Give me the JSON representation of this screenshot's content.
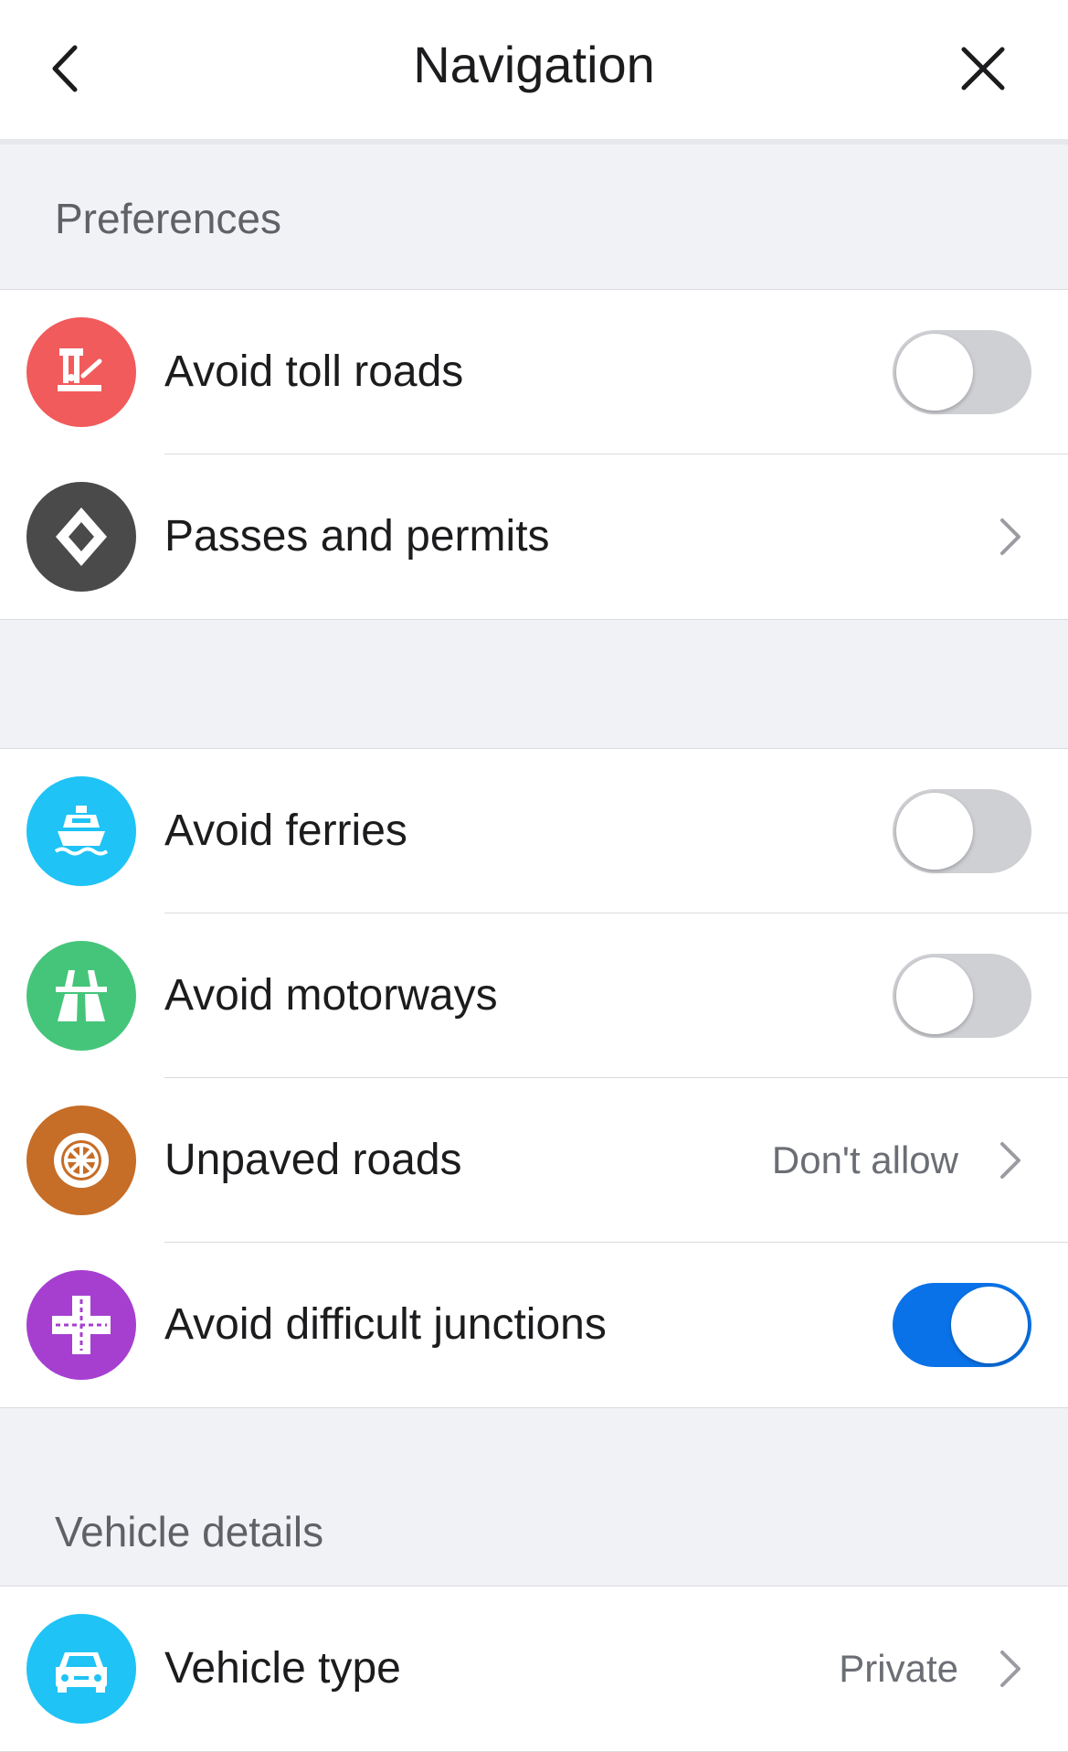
{
  "header": {
    "title": "Navigation"
  },
  "sections": {
    "preferences": "Preferences",
    "vehicle_details": "Vehicle details"
  },
  "rows": {
    "toll": {
      "label": "Avoid toll roads",
      "toggle_on": false,
      "icon": "toll-booth-icon",
      "color": "#f15b5b"
    },
    "passes": {
      "label": "Passes and permits",
      "icon": "diamond-icon",
      "color": "#4a4a4a"
    },
    "ferries": {
      "label": "Avoid ferries",
      "toggle_on": false,
      "icon": "ferry-icon",
      "color": "#1fc3f5"
    },
    "motorways": {
      "label": "Avoid motorways",
      "toggle_on": false,
      "icon": "motorway-icon",
      "color": "#45c57a"
    },
    "unpaved": {
      "label": "Unpaved roads",
      "value": "Don't allow",
      "icon": "wheel-icon",
      "color": "#c66d27"
    },
    "junctions": {
      "label": "Avoid difficult junctions",
      "toggle_on": true,
      "icon": "junction-icon",
      "color": "#a63fd0"
    },
    "vehicle": {
      "label": "Vehicle type",
      "value": "Private",
      "icon": "car-icon",
      "color": "#1fc3f5"
    }
  },
  "colors": {
    "toggle_on": "#0a72e8",
    "toggle_off": "#cfd0d4"
  }
}
